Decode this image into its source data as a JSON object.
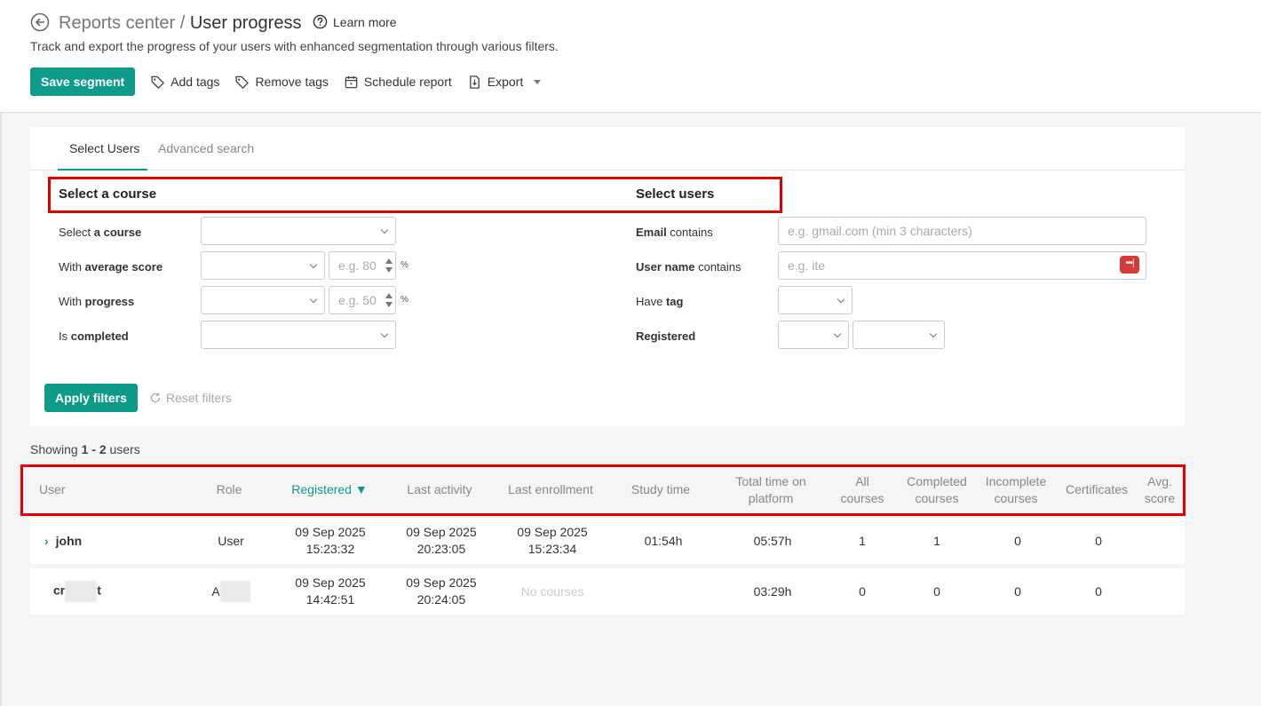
{
  "header": {
    "breadcrumb_parent": "Reports center",
    "separator": " / ",
    "page_title": "User progress",
    "learn_more": "Learn more",
    "subtitle": "Track and export the progress of your users with enhanced segmentation through various filters."
  },
  "toolbar": {
    "save_segment": "Save segment",
    "add_tags": "Add tags",
    "remove_tags": "Remove tags",
    "schedule_report": "Schedule report",
    "export": "Export"
  },
  "tabs": {
    "select_users": "Select Users",
    "advanced_search": "Advanced search"
  },
  "course_filters": {
    "section_title": "Select a course",
    "select_course": {
      "prefix": "Select ",
      "strong": "a course"
    },
    "average_score": {
      "prefix": "With ",
      "strong": "average score",
      "placeholder": "e.g. 80",
      "unit": "%"
    },
    "progress": {
      "prefix": "With ",
      "strong": "progress",
      "placeholder": "e.g. 50",
      "unit": "%"
    },
    "completed": {
      "prefix": "Is ",
      "strong": "completed"
    }
  },
  "user_filters": {
    "section_title": "Select users",
    "email": {
      "strong": "Email",
      "suffix": " contains",
      "placeholder": "e.g. gmail.com (min 3 characters)"
    },
    "username": {
      "strong": "User name",
      "suffix": " contains",
      "placeholder": "e.g. ite",
      "password_badge": "•••|"
    },
    "tag": {
      "prefix": "Have ",
      "strong": "tag"
    },
    "registered": {
      "strong": "Registered"
    }
  },
  "actions": {
    "apply_filters": "Apply filters",
    "reset_filters": "Reset filters"
  },
  "results": {
    "prefix": "Showing ",
    "range": "1 - 2",
    "suffix": " users"
  },
  "table": {
    "columns": [
      {
        "label": "User"
      },
      {
        "label": "Role"
      },
      {
        "label": "Registered ▼"
      },
      {
        "label": "Last activity"
      },
      {
        "label": "Last enrollment"
      },
      {
        "label": "Study time"
      },
      {
        "label": "Total time on platform"
      },
      {
        "label": "All courses"
      },
      {
        "label": "Completed courses"
      },
      {
        "label": "Incomplete courses"
      },
      {
        "label": "Certificates"
      },
      {
        "label": "Avg. score"
      }
    ],
    "rows": [
      {
        "user": "john",
        "role": "User",
        "registered": "09 Sep 2025 15:23:32",
        "last_activity": "09 Sep 2025 20:23:05",
        "last_enrollment": "09 Sep 2025 15:23:34",
        "study_time": "01:54h",
        "total_time": "05:57h",
        "all_courses": "1",
        "completed": "1",
        "incomplete": "0",
        "certificates": "0",
        "avg_score": ""
      },
      {
        "user_start": "cr",
        "user_end": "t",
        "role_start": "A",
        "registered": "09 Sep 2025 14:42:51",
        "last_activity": "09 Sep 2025 20:24:05",
        "last_enrollment": "No courses",
        "study_time": "",
        "total_time": "03:29h",
        "all_courses": "0",
        "completed": "0",
        "incomplete": "0",
        "certificates": "0",
        "avg_score": ""
      }
    ]
  },
  "colors": {
    "accent": "#0f9b8a",
    "highlight": "#e00000",
    "badge": "#d63a3a"
  }
}
